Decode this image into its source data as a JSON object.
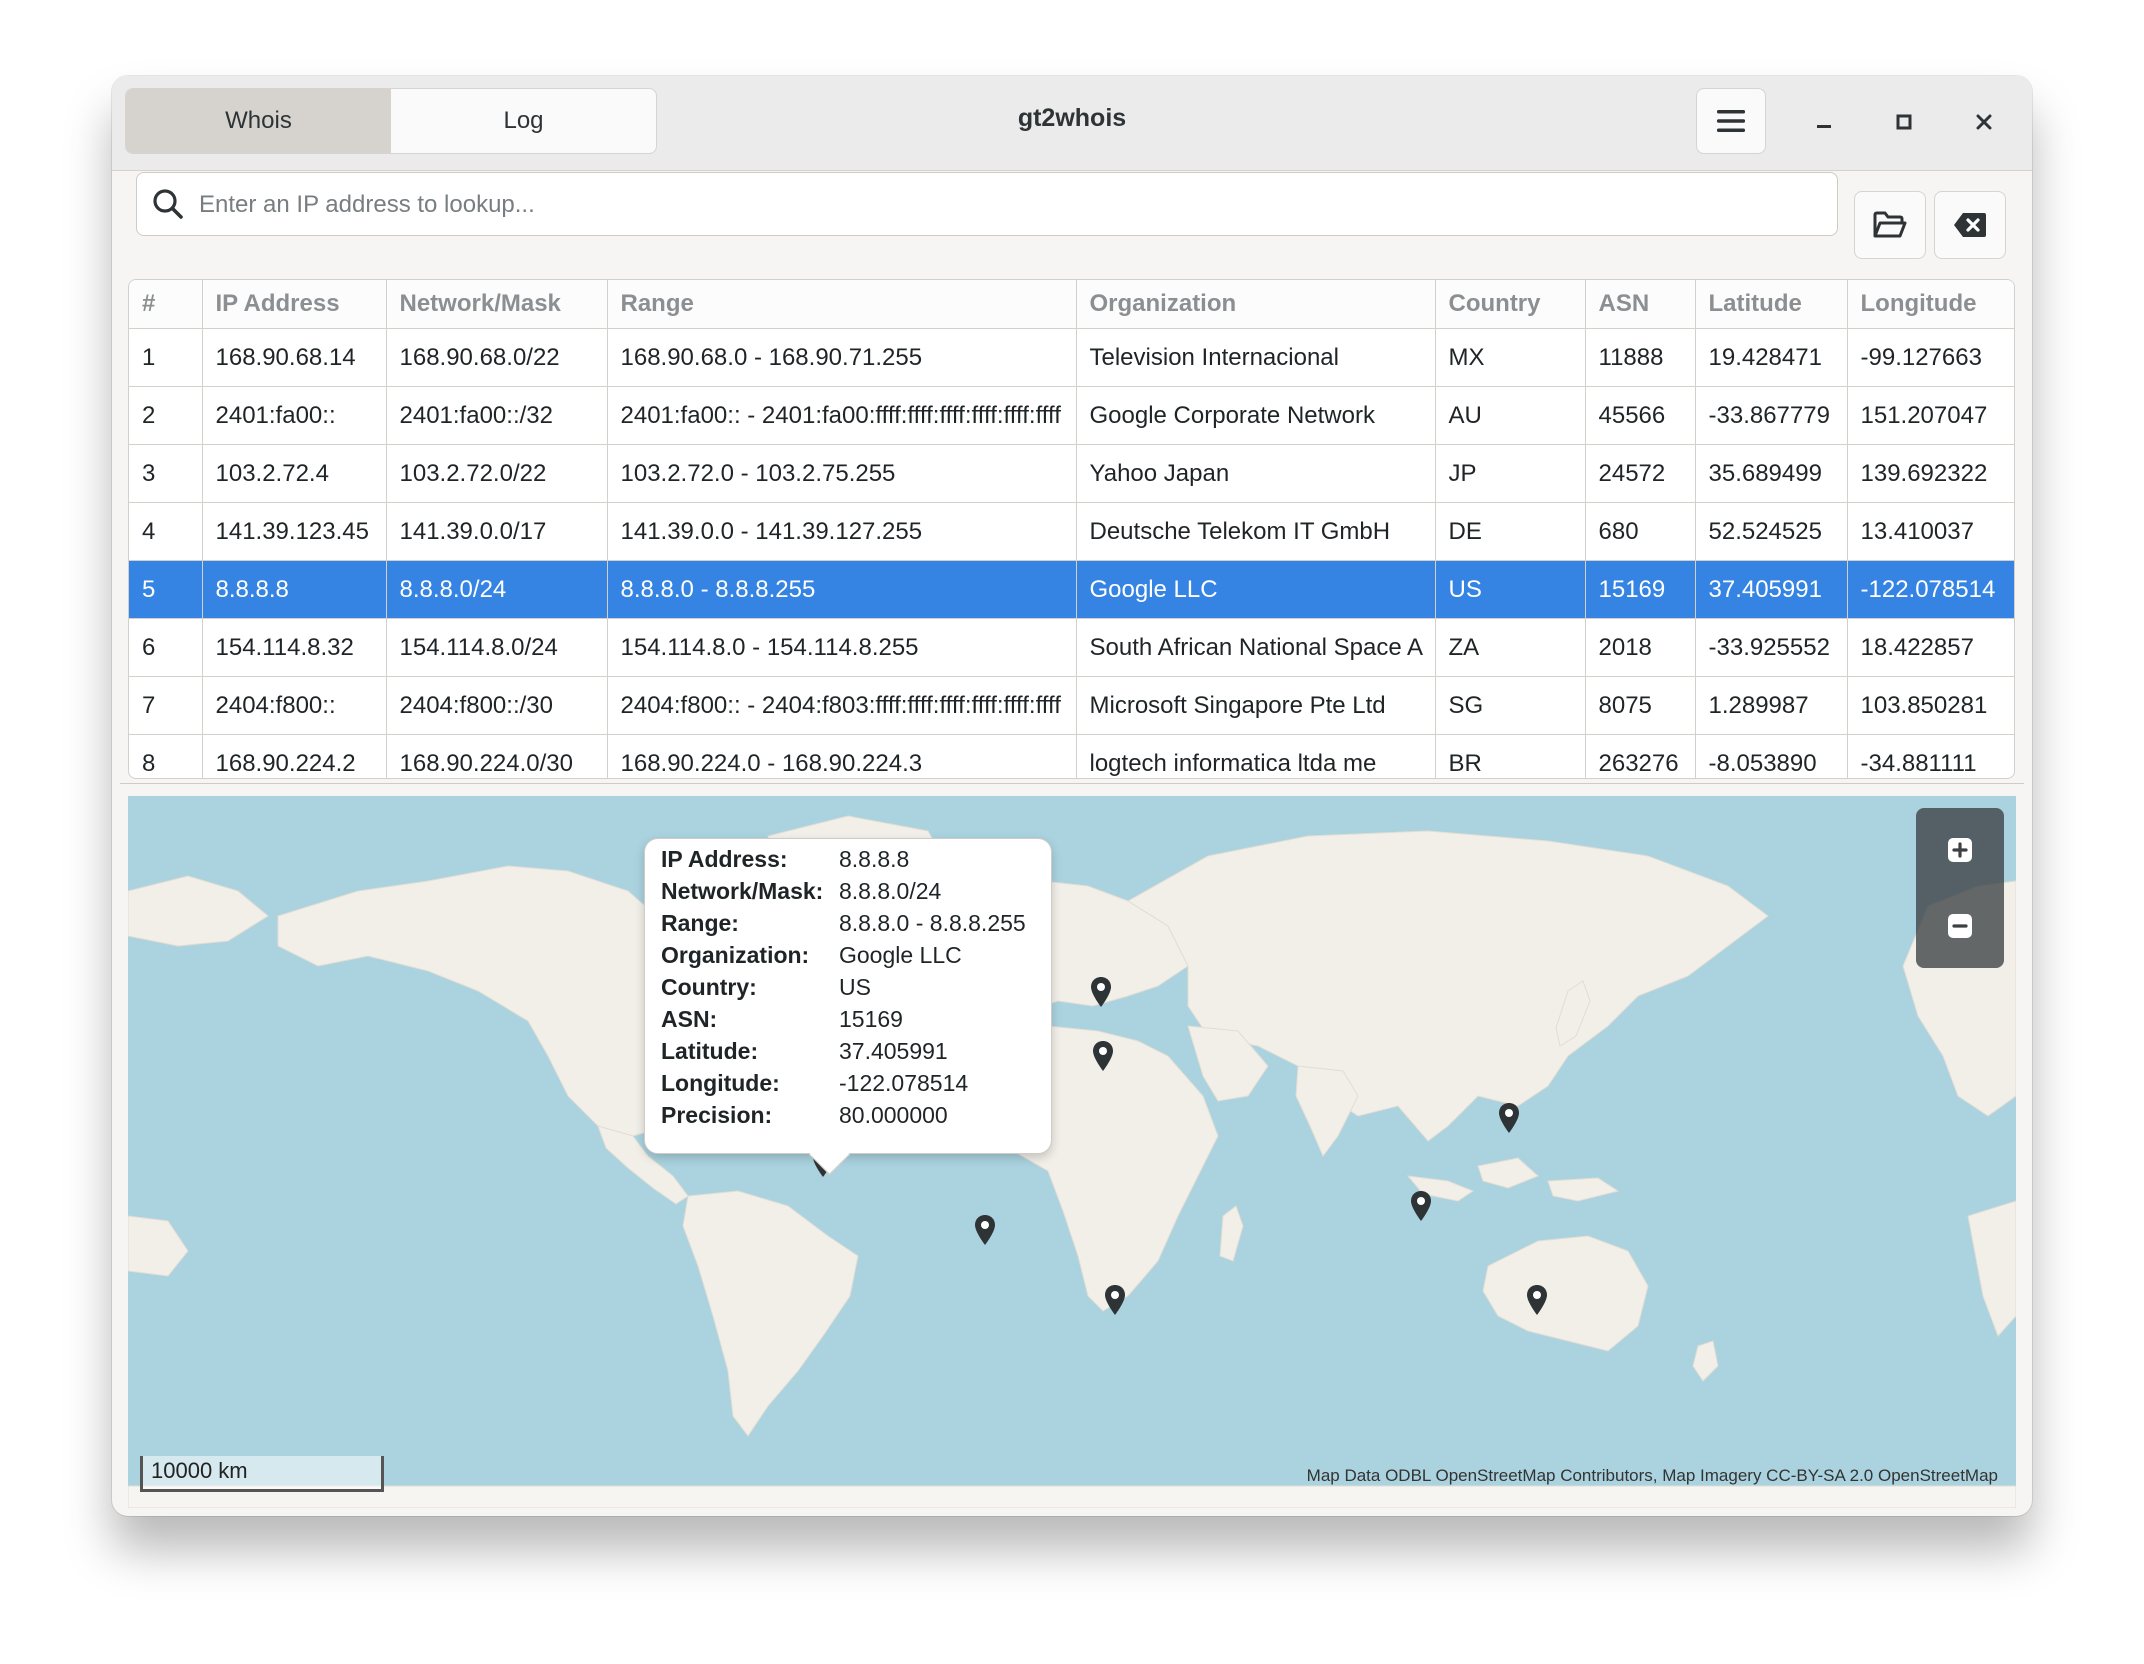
{
  "header": {
    "tabs": [
      {
        "label": "Whois",
        "active": true
      },
      {
        "label": "Log",
        "active": false
      }
    ],
    "title": "gt2whois",
    "menu_icon": "hamburger-menu-icon"
  },
  "search": {
    "placeholder": "Enter an IP address to lookup...",
    "value": "",
    "icon": "search-icon"
  },
  "toolbar": {
    "open_icon": "folder-open-icon",
    "clear_icon": "backspace-clear-icon"
  },
  "table": {
    "columns": [
      "#",
      "IP Address",
      "Network/Mask",
      "Range",
      "Organization",
      "Country",
      "ASN",
      "Latitude",
      "Longitude"
    ],
    "rows": [
      [
        "1",
        "168.90.68.14",
        "168.90.68.0/22",
        "168.90.68.0 - 168.90.71.255",
        "Television Internacional",
        "MX",
        "11888",
        "19.428471",
        "-99.127663"
      ],
      [
        "2",
        "2401:fa00::",
        "2401:fa00::/32",
        "2401:fa00:: - 2401:fa00:ffff:ffff:ffff:ffff:ffff:ffff",
        "Google Corporate Network",
        "AU",
        "45566",
        "-33.867779",
        "151.207047"
      ],
      [
        "3",
        "103.2.72.4",
        "103.2.72.0/22",
        "103.2.72.0 - 103.2.75.255",
        "Yahoo Japan",
        "JP",
        "24572",
        "35.689499",
        "139.692322"
      ],
      [
        "4",
        "141.39.123.45",
        "141.39.0.0/17",
        "141.39.0.0 - 141.39.127.255",
        "Deutsche Telekom IT GmbH",
        "DE",
        "680",
        "52.524525",
        "13.410037"
      ],
      [
        "5",
        "8.8.8.8",
        "8.8.8.0/24",
        "8.8.8.0 - 8.8.8.255",
        "Google LLC",
        "US",
        "15169",
        "37.405991",
        "-122.078514"
      ],
      [
        "6",
        "154.114.8.32",
        "154.114.8.0/24",
        "154.114.8.0 - 154.114.8.255",
        "South African National Space A",
        "ZA",
        "2018",
        "-33.925552",
        "18.422857"
      ],
      [
        "7",
        "2404:f800::",
        "2404:f800::/30",
        "2404:f800:: - 2404:f803:ffff:ffff:ffff:ffff:ffff:ffff",
        "Microsoft Singapore Pte Ltd",
        "SG",
        "8075",
        "1.289987",
        "103.850281"
      ],
      [
        "8",
        "168.90.224.2",
        "168.90.224.0/30",
        "168.90.224.0 - 168.90.224.3",
        "logtech informatica ltda me",
        "BR",
        "263276",
        "-8.053890",
        "-34.881111"
      ]
    ],
    "selected_index": 4
  },
  "popup": {
    "rows": [
      {
        "key": "IP Address:",
        "value": "8.8.8.8"
      },
      {
        "key": "Network/Mask:",
        "value": "8.8.8.0/24"
      },
      {
        "key": "Range:",
        "value": "8.8.8.0 - 8.8.8.255"
      },
      {
        "key": "Organization:",
        "value": "Google LLC"
      },
      {
        "key": "Country:",
        "value": "US"
      },
      {
        "key": "ASN:",
        "value": "15169"
      },
      {
        "key": "Latitude:",
        "value": "37.405991"
      },
      {
        "key": "Longitude:",
        "value": "-122.078514"
      },
      {
        "key": "Precision:",
        "value": "80.000000"
      }
    ]
  },
  "map": {
    "scale_label": "10000 km",
    "attribution": "Map Data ODBL OpenStreetMap Contributors, Map Imagery CC-BY-SA 2.0 OpenStreetMap",
    "zoom_in_icon": "zoom-in-icon",
    "zoom_out_icon": "zoom-out-icon",
    "selected_pin_color": "#e01b24",
    "pin_color": "#2e3436",
    "water_color": "#aad3df",
    "land_color": "#f2efe9"
  },
  "colors": {
    "accent": "#3584e4"
  }
}
